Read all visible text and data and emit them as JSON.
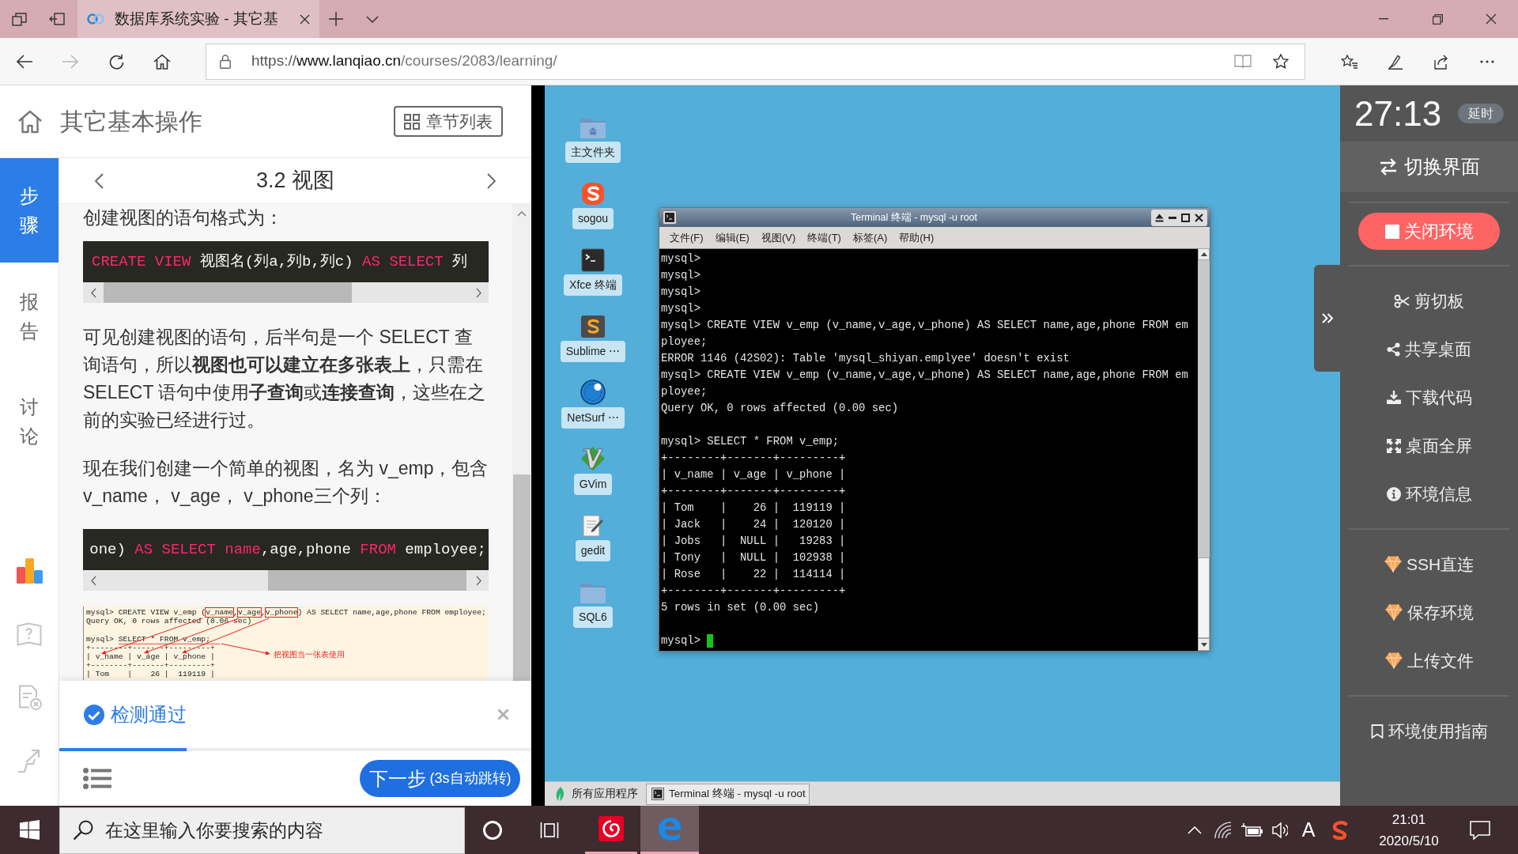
{
  "browser": {
    "tabs": [
      {
        "title": "数据库系统实验 - 其它基",
        "selected": true
      }
    ],
    "nav_buttons": [
      {
        "kind": "back",
        "disabled": false
      },
      {
        "kind": "forward",
        "disabled": true
      },
      {
        "kind": "refresh",
        "disabled": false
      },
      {
        "kind": "home",
        "disabled": false
      }
    ],
    "url": {
      "scheme": "https://",
      "host": "www.lanqiao.cn",
      "path": "/courses/2083/learning/"
    }
  },
  "course": {
    "title": "其它基本操作",
    "chapter_button": "章节列表",
    "nav": [
      {
        "label": "步骤",
        "selected": true
      },
      {
        "label": "报告",
        "selected": false
      },
      {
        "label": "讨论",
        "selected": false
      }
    ],
    "section_title": "3.2 视图",
    "content": [
      {
        "kind": "text",
        "text": "创建视图的语句格式为："
      },
      {
        "kind": "code",
        "tokens": [
          {
            "kind": "keyword",
            "text": "CREATE VIEW"
          },
          {
            "kind": "plain",
            "text": " 视图名(列a,列b,列c) "
          },
          {
            "kind": "keyword",
            "text": "AS SELECT"
          },
          {
            "kind": "plain",
            "text": " 列"
          }
        ]
      },
      {
        "kind": "text",
        "text": "可见创建视图的语句，后半句是一个 SELECT 查询语句，所以**视图也可以建立在多张表上**，只需在 SELECT 语句中使用**子查询**或**连接查询**，这些在之前的实验已经进行过。"
      },
      {
        "kind": "text",
        "text": "现在我们创建一个简单的视图，名为 v_emp，包含v_name， v_age， v_phone三个列："
      },
      {
        "kind": "code",
        "tokens": [
          {
            "kind": "plain",
            "text": "one) "
          },
          {
            "kind": "keyword",
            "text": "AS SELECT name"
          },
          {
            "kind": "plain",
            "text": ",age,phone "
          },
          {
            "kind": "keyword",
            "text": "FROM"
          },
          {
            "kind": "plain",
            "text": " employee;"
          }
        ]
      },
      {
        "kind": "image",
        "blocks": [
          {
            "lines": [
              {
                "segments": [
                  {
                    "text": "mysql> CREATE VIEW v_emp (",
                    "boxed": false
                  },
                  {
                    "text": "v_name",
                    "boxed": true
                  },
                  {
                    "text": ",",
                    "boxed": false
                  },
                  {
                    "text": "v_age",
                    "boxed": true
                  },
                  {
                    "text": ",",
                    "boxed": false
                  },
                  {
                    "text": "v_phone",
                    "boxed": true
                  },
                  {
                    "text": ") AS SELECT name,age,phone FROM employee;",
                    "boxed": false
                  }
                ]
              },
              {
                "segments": [
                  {
                    "text": "Query OK, 0 rows affected (0.06 sec)",
                    "boxed": false
                  }
                ]
              }
            ]
          },
          {
            "lines": [
              {
                "segments": [
                  {
                    "text": "mysql> SELECT * FROM v_emp;",
                    "boxed": false
                  }
                ]
              },
              {
                "segments": [
                  {
                    "text": "+--------+-------+---------+",
                    "boxed": false
                  }
                ]
              },
              {
                "segments": [
                  {
                    "text": "| v_name | v_age | v_phone |",
                    "boxed": false
                  }
                ]
              },
              {
                "segments": [
                  {
                    "text": "+--------+-------+---------+",
                    "boxed": false
                  }
                ]
              },
              {
                "segments": [
                  {
                    "text": "| Tom    |    26 |  119119 |",
                    "boxed": false
                  }
                ]
              }
            ]
          }
        ],
        "note": "把视图当一张表使用"
      }
    ],
    "check": {
      "status": "检测通过",
      "level": 0.27
    },
    "next_button": {
      "label": "下一步",
      "hint": "(3s自动跳转)"
    }
  },
  "desktop": {
    "icons": [
      {
        "kind": "home-folder",
        "label": "主文件夹"
      },
      {
        "kind": "sogou",
        "label": "sogou"
      },
      {
        "kind": "terminal",
        "label": "Xfce 终端"
      },
      {
        "kind": "sublime",
        "label": "Sublime ⋯"
      },
      {
        "kind": "netsurf",
        "label": "NetSurf ⋯"
      },
      {
        "kind": "gvim",
        "label": "GVim"
      },
      {
        "kind": "gedit",
        "label": "gedit"
      },
      {
        "kind": "folder",
        "label": "SQL6"
      }
    ],
    "terminal": {
      "title": "Terminal 终端 - mysql -u root",
      "menu": [
        "文件(F)",
        "编辑(E)",
        "视图(V)",
        "终端(T)",
        "标签(A)",
        "帮助(H)"
      ],
      "blocks": [
        {
          "lines": [
            {
              "text": "mysql>",
              "cursor": false
            },
            {
              "text": "mysql>",
              "cursor": false
            },
            {
              "text": "mysql>",
              "cursor": false
            },
            {
              "text": "mysql>",
              "cursor": false
            },
            {
              "text": "mysql> CREATE VIEW v_emp (v_name,v_age,v_phone) AS SELECT name,age,phone FROM em",
              "cursor": false
            },
            {
              "text": "ployee;",
              "cursor": false
            },
            {
              "text": "ERROR 1146 (42S02): Table 'mysql_shiyan.emplyee' doesn't exist",
              "cursor": false
            },
            {
              "text": "mysql> CREATE VIEW v_emp (v_name,v_age,v_phone) AS SELECT name,age,phone FROM em",
              "cursor": false
            },
            {
              "text": "ployee;",
              "cursor": false
            },
            {
              "text": "Query OK, 0 rows affected (0.00 sec)",
              "cursor": false
            }
          ]
        },
        {
          "lines": [
            {
              "text": "mysql> SELECT * FROM v_emp;",
              "cursor": false
            },
            {
              "text": "+--------+-------+---------+",
              "cursor": false
            },
            {
              "text": "| v_name | v_age | v_phone |",
              "cursor": false
            },
            {
              "text": "+--------+-------+---------+",
              "cursor": false
            },
            {
              "text": "| Tom    |    26 |  119119 |",
              "cursor": false
            },
            {
              "text": "| Jack   |    24 |  120120 |",
              "cursor": false
            },
            {
              "text": "| Jobs   |  NULL |   19283 |",
              "cursor": false
            },
            {
              "text": "| Tony   |  NULL |  102938 |",
              "cursor": false
            },
            {
              "text": "| Rose   |    22 |  114114 |",
              "cursor": false
            },
            {
              "text": "+--------+-------+---------+",
              "cursor": false
            },
            {
              "text": "5 rows in set (0.00 sec)",
              "cursor": false
            }
          ]
        },
        {
          "lines": [
            {
              "text": "mysql>",
              "cursor": true
            }
          ]
        }
      ]
    },
    "panel": {
      "apps_menu": "所有应用程序",
      "tasks": [
        {
          "title": "Terminal 终端 - mysql -u root",
          "selected": true
        }
      ]
    }
  },
  "sidebar": {
    "timer": "27:13",
    "extend_button": "延时",
    "switch_button": "切换界面",
    "close_button": "关闭环境",
    "menu_groups": [
      {
        "items": [
          {
            "kind": "clipboard",
            "label": "剪切板"
          },
          {
            "kind": "share",
            "label": "共享桌面"
          },
          {
            "kind": "download",
            "label": "下载代码"
          },
          {
            "kind": "fullscreen",
            "label": "桌面全屏"
          },
          {
            "kind": "info",
            "label": "环境信息"
          }
        ]
      },
      {
        "items": [
          {
            "kind": "premium",
            "label": "SSH直连"
          },
          {
            "kind": "premium",
            "label": "保存环境"
          },
          {
            "kind": "premium",
            "label": "上传文件"
          }
        ]
      },
      {
        "items": [
          {
            "kind": "guide",
            "label": "环境使用指南"
          }
        ]
      }
    ]
  },
  "taskbar": {
    "search_placeholder": "在这里输入你要搜索的内容",
    "apps": [
      {
        "kind": "music",
        "selected": false
      },
      {
        "kind": "browser",
        "selected": true
      }
    ],
    "ime": "A",
    "time": "21:01",
    "date": "2020/5/10"
  }
}
